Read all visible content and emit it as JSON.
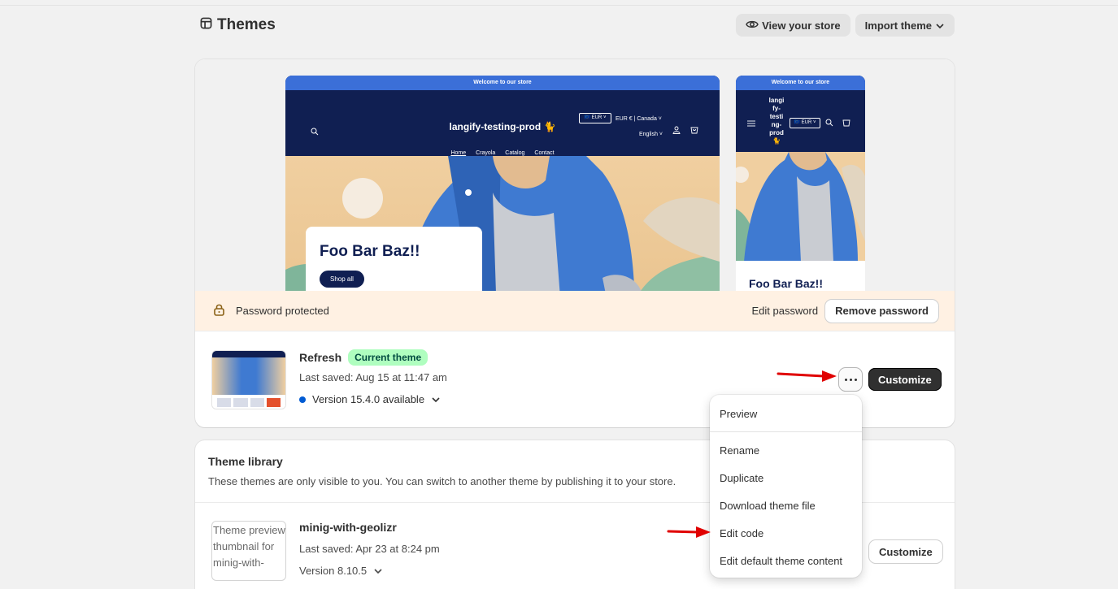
{
  "page": {
    "title": "Themes",
    "view_store_label": "View your store",
    "import_theme_label": "Import theme"
  },
  "preview": {
    "announcement": "Welcome to our store",
    "store_name": "langify-testing-prod 🐈",
    "mobile_store_name_lines": [
      "langi",
      "fy-",
      "testi",
      "ng-",
      "prod",
      "🐈"
    ],
    "currency_pill": "🇪🇺 EUR ˅",
    "locale": "EUR € | Canada ˅",
    "language": "English ˅",
    "nav": [
      "Home",
      "Crayola",
      "Catalog",
      "Contact"
    ],
    "hero_title": "Foo Bar Baz!!",
    "shop_all": "Shop all"
  },
  "password_bar": {
    "label": "Password protected",
    "edit_label": "Edit password",
    "remove_label": "Remove password"
  },
  "current_theme": {
    "name": "Refresh",
    "badge": "Current theme",
    "saved": "Last saved: Aug 15 at 11:47 am",
    "version": "Version 15.4.0 available",
    "customize_label": "Customize"
  },
  "library": {
    "title": "Theme library",
    "description": "These themes are only visible to you. You can switch to another theme by publishing it to your store.",
    "themes": [
      {
        "name": "minig-with-geolizr",
        "saved": "Last saved: Apr 23 at 8:24 pm",
        "version": "Version 8.10.5",
        "thumb_alt": "Theme preview thumbnail for minig-with-",
        "customize_label": "Customize"
      }
    ]
  },
  "menu": {
    "items": [
      "Preview",
      "Rename",
      "Duplicate",
      "Download theme file",
      "Edit code",
      "Edit default theme content"
    ]
  },
  "colors": {
    "accent": "#303030",
    "badge_green": "#affebf",
    "password_bg": "#fff1e3",
    "annotation_arrow": "#e00000",
    "info_blue": "#005bd3"
  }
}
